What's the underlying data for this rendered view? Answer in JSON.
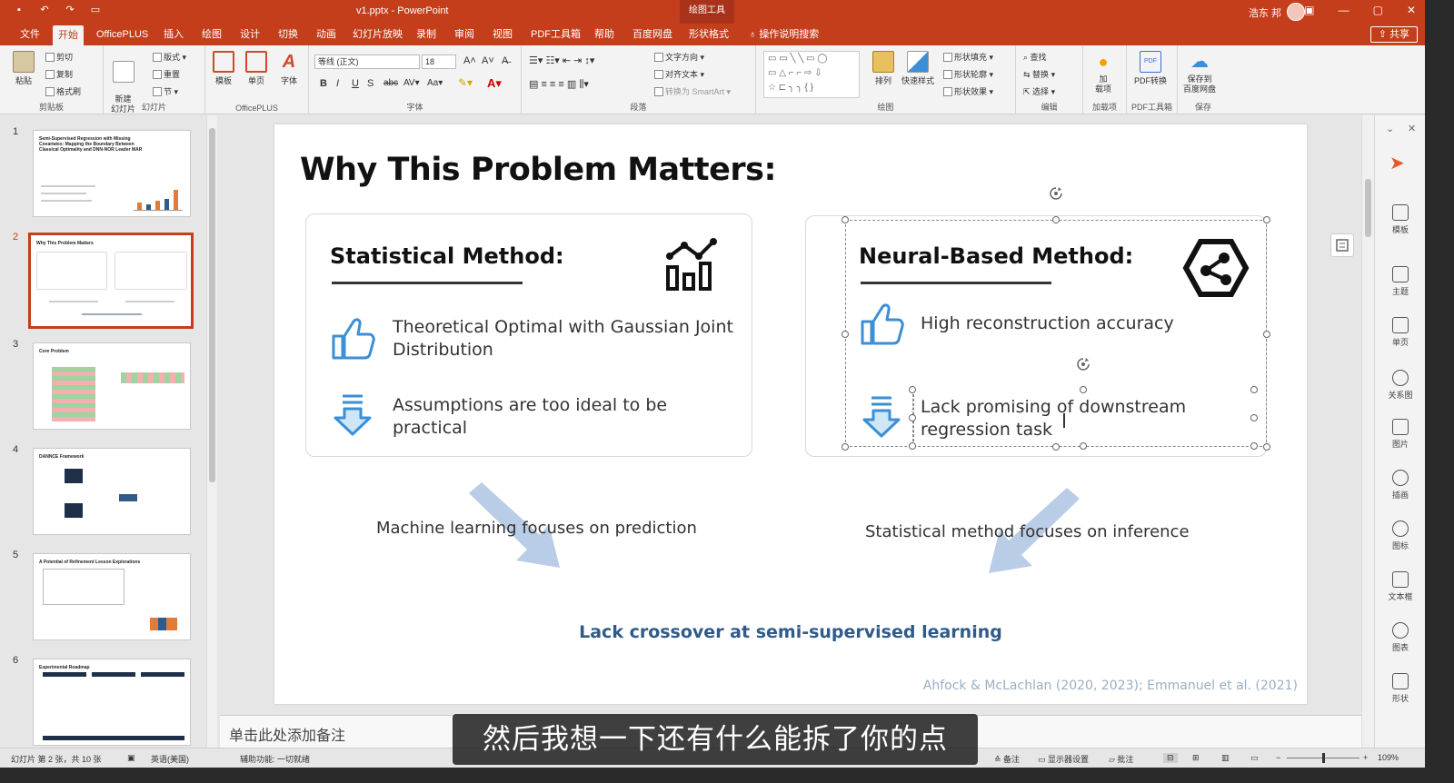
{
  "titlebar": {
    "quick_access": [
      "save-icon",
      "undo-icon",
      "redo-icon",
      "present-icon"
    ],
    "file_title": "v1.pptx  -  PowerPoint",
    "context_tools": "绘图工具",
    "user": "浩东 邦",
    "window_buttons": [
      "▣",
      "—",
      "▢",
      "✕"
    ]
  },
  "menu": {
    "items": [
      "文件",
      "开始",
      "OfficePLUS",
      "插入",
      "绘图",
      "设计",
      "切换",
      "动画",
      "幻灯片放映",
      "录制",
      "审阅",
      "视图",
      "PDF工具箱",
      "帮助",
      "百度网盘",
      "形状格式"
    ],
    "active": "开始",
    "search": "操作说明搜索",
    "share": "共享"
  },
  "ribbon": {
    "clipboard": {
      "paste": "粘贴",
      "cut": "剪切",
      "copy": "复制",
      "format_painter": "格式刷",
      "label": "剪贴板"
    },
    "slides": {
      "new_slide": "新建\n幻灯片",
      "layout": "版式",
      "reset": "重置",
      "section": "节",
      "label": "幻灯片"
    },
    "officeplus": {
      "template": "模板",
      "single": "单页",
      "font": "字体",
      "label": "OfficePLUS"
    },
    "font": {
      "font_name": "等线 (正文)",
      "font_size": "18",
      "label": "字体"
    },
    "paragraph": {
      "text_direction": "文字方向",
      "align_text": "对齐文本",
      "smartart": "转换为 SmartArt",
      "label": "段落"
    },
    "drawing": {
      "arrange": "排列",
      "quick_styles": "快速样式",
      "shape_fill": "形状填充",
      "shape_outline": "形状轮廓",
      "shape_effects": "形状效果",
      "label": "绘图"
    },
    "editing": {
      "find": "查找",
      "replace": "替换",
      "select": "选择",
      "label": "编辑"
    },
    "addins": {
      "add": "加\n载项",
      "label": "加载项"
    },
    "pdf": {
      "convert": "PDF转换",
      "label": "PDF工具箱"
    },
    "save": {
      "save_to": "保存到\n百度网盘",
      "label": "保存"
    }
  },
  "thumbnails": [
    {
      "num": "1",
      "title": "Semi-Supervised Regression with Missing Covariates: Mapping the Boundary Between Classical Optimality and DNN-NOR Leader MAR"
    },
    {
      "num": "2",
      "title": "Why This Problem Matters"
    },
    {
      "num": "3",
      "title": "Core Problem"
    },
    {
      "num": "4",
      "title": "DANNCE Framework"
    },
    {
      "num": "5",
      "title": "A Potential of Refinement Lesson Explorations"
    },
    {
      "num": "6",
      "title": "Experimental Roadmap"
    }
  ],
  "slide": {
    "title": "Why This Problem Matters:",
    "left_card": {
      "heading": "Statistical Method:",
      "pro": "Theoretical Optimal with Gaussian Joint Distribution",
      "con": "Assumptions are too ideal to be practical"
    },
    "right_card": {
      "heading": "Neural-Based Method:",
      "pro": "High reconstruction accuracy",
      "con": "Lack promising of downstream regression task"
    },
    "left_note": "Machine learning focuses on prediction",
    "right_note": "Statistical method focuses on inference",
    "crossover": "Lack crossover at semi-supervised learning",
    "citation": "Ahfock & McLachlan (2020, 2023); Emmanuel et al. (2021)"
  },
  "right_panel": [
    "模板",
    "主题",
    "单页",
    "关系图",
    "图片",
    "插画",
    "图标",
    "文本框",
    "图表",
    "形状"
  ],
  "notes_placeholder": "单击此处添加备注",
  "subtitle": "然后我想一下还有什么能拆了你的点",
  "status": {
    "slide_info": "幻灯片 第 2 张，共 10 张",
    "language": "英语(美国)",
    "accessibility": "辅助功能: 一切就绪",
    "notes": "备注",
    "display_settings": "显示器设置",
    "comments": "批注",
    "zoom": "109%"
  },
  "colors": {
    "accent": "#c43e1c",
    "icon_blue": "#3a8fd6",
    "crossover_text": "#2f5a8a",
    "citation": "#9aaec4"
  }
}
